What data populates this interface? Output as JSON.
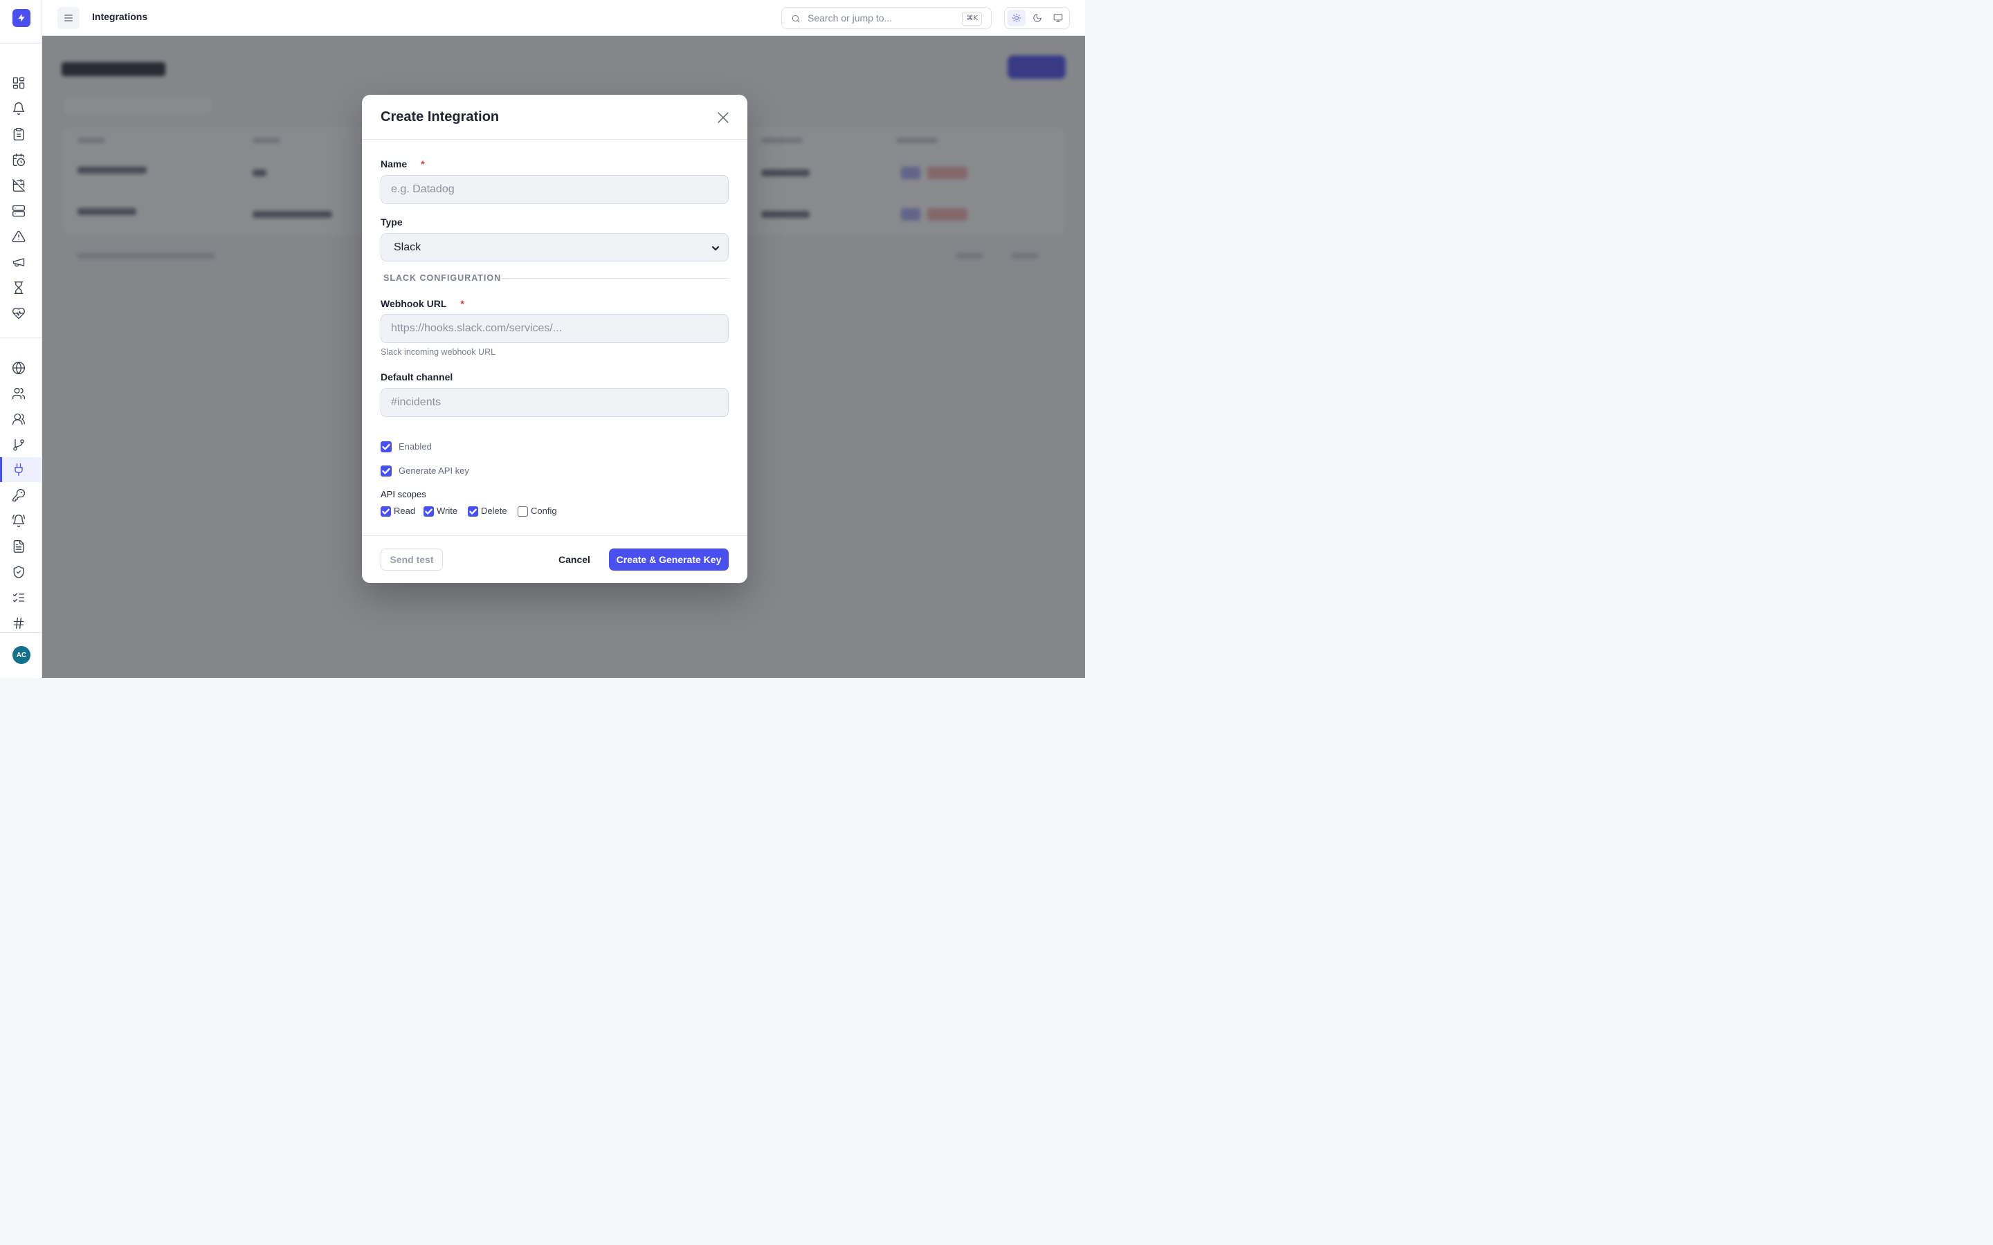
{
  "topbar": {
    "title": "Integrations",
    "search_placeholder": "Search or jump to...",
    "search_shortcut": "⌘K",
    "theme_options": [
      "light-theme",
      "dark-theme",
      "system-theme"
    ],
    "active_theme": "light"
  },
  "sidebar": {
    "avatar_initials": "AC",
    "active_item": "integrations",
    "accent_color": "#4a50f0",
    "items": [
      "dashboard-icon",
      "bell-icon",
      "clipboard-icon",
      "calendar-clock-icon",
      "calendar-off-icon",
      "server-icon",
      "alert-triangle-icon",
      "megaphone-icon",
      "hourglass-icon",
      "heart-pulse-icon",
      "globe-icon",
      "users-icon",
      "team-icon",
      "git-branch-icon",
      "plug-icon",
      "key-icon",
      "bell-ring-icon",
      "file-text-icon",
      "shield-check-icon",
      "list-checks-icon",
      "hash-icon"
    ]
  },
  "modal": {
    "title": "Create Integration",
    "name": {
      "label": "Name",
      "required_mark": "*",
      "placeholder": "e.g. Datadog",
      "value": ""
    },
    "type": {
      "label": "Type",
      "value": "Slack"
    },
    "section_title": "SLACK CONFIGURATION",
    "webhook": {
      "label": "Webhook URL",
      "required_mark": "*",
      "placeholder": "https://hooks.slack.com/services/...",
      "help": "Slack incoming webhook URL"
    },
    "channel": {
      "label": "Default channel",
      "placeholder": "#incidents"
    },
    "enabled": {
      "label": "Enabled",
      "checked": true
    },
    "generate_key": {
      "label": "Generate API key",
      "checked": true
    },
    "scopes": {
      "title": "API scopes",
      "items": [
        {
          "label": "Read",
          "checked": true
        },
        {
          "label": "Write",
          "checked": true
        },
        {
          "label": "Delete",
          "checked": true
        },
        {
          "label": "Config",
          "checked": false
        }
      ]
    },
    "buttons": {
      "test": "Send test",
      "cancel": "Cancel",
      "submit": "Create & Generate Key"
    }
  }
}
